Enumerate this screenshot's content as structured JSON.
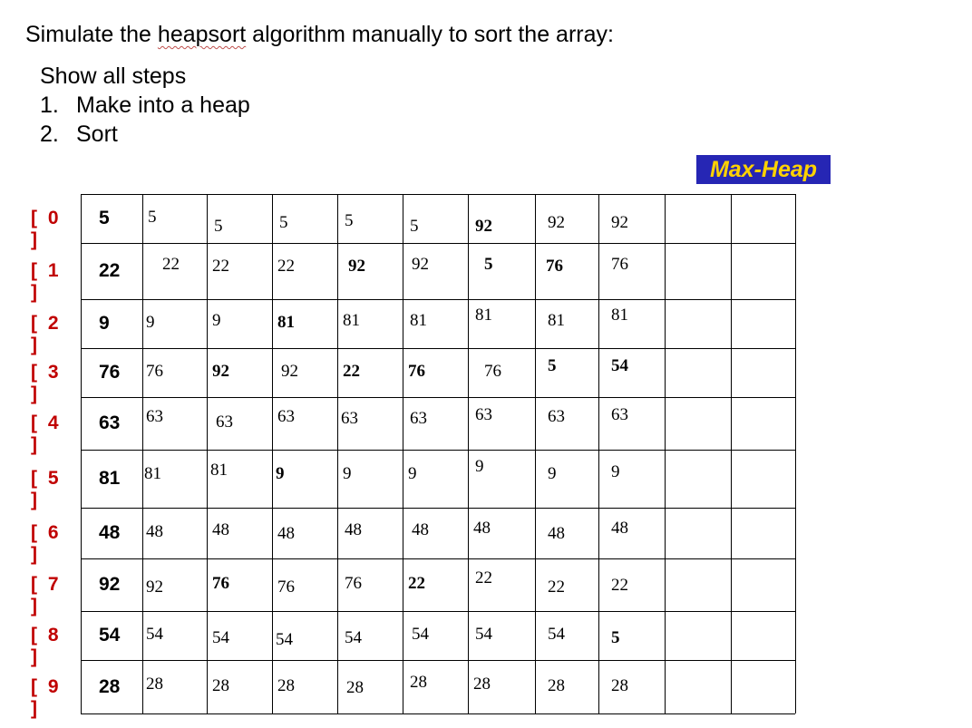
{
  "header": {
    "title_before": "Simulate the ",
    "title_word": "heapsort",
    "title_after": " algorithm manually to sort the array:"
  },
  "instructions": {
    "show_all": "Show all steps",
    "step1_num": "1.",
    "step1_text": "Make into a heap",
    "step2_num": "2.",
    "step2_text": "Sort"
  },
  "badge": "Max-Heap",
  "indices": [
    "[ 0 ]",
    "[ 1 ]",
    "[ 2 ]",
    "[ 3 ]",
    "[ 4 ]",
    "[ 5 ]",
    "[ 6 ]",
    "[ 7 ]",
    "[ 8 ]",
    "[ 9 ]"
  ],
  "table": {
    "columns": [
      [
        "5",
        "22",
        "9",
        "76",
        "63",
        "81",
        "48",
        "92",
        "54",
        "28"
      ],
      [
        "5",
        "22",
        "9",
        "76",
        "63",
        "81",
        "48",
        "92",
        "54",
        "28"
      ],
      [
        "5",
        "22",
        "9",
        "92",
        "63",
        "81",
        "48",
        "76",
        "54",
        "28"
      ],
      [
        "5",
        "22",
        "81",
        "92",
        "63",
        "9",
        "48",
        "76",
        "54",
        "28"
      ],
      [
        "5",
        "92",
        "81",
        "22",
        "63",
        "9",
        "48",
        "76",
        "54",
        "28"
      ],
      [
        "5",
        "92",
        "81",
        "76",
        "63",
        "9",
        "48",
        "22",
        "54",
        "28"
      ],
      [
        "92",
        "5",
        "81",
        "76",
        "63",
        "9",
        "48",
        "22",
        "54",
        "28"
      ],
      [
        "92",
        "76",
        "81",
        "5",
        "63",
        "9",
        "48",
        "22",
        "54",
        "28"
      ],
      [
        "92",
        "76",
        "81",
        "54",
        "63",
        "9",
        "48",
        "22",
        "5",
        "28"
      ],
      [
        "",
        "",
        "",
        "",
        "",
        "",
        "",
        "",
        "",
        ""
      ],
      [
        "",
        "",
        "",
        "",
        "",
        "",
        "",
        "",
        "",
        ""
      ]
    ],
    "bold_cells": [
      [
        2,
        3
      ],
      [
        2,
        7
      ],
      [
        3,
        2
      ],
      [
        3,
        5
      ],
      [
        4,
        1
      ],
      [
        4,
        3
      ],
      [
        5,
        3
      ],
      [
        5,
        7
      ],
      [
        6,
        0
      ],
      [
        6,
        1
      ],
      [
        7,
        1
      ],
      [
        7,
        3
      ],
      [
        8,
        3
      ],
      [
        8,
        8
      ]
    ]
  }
}
